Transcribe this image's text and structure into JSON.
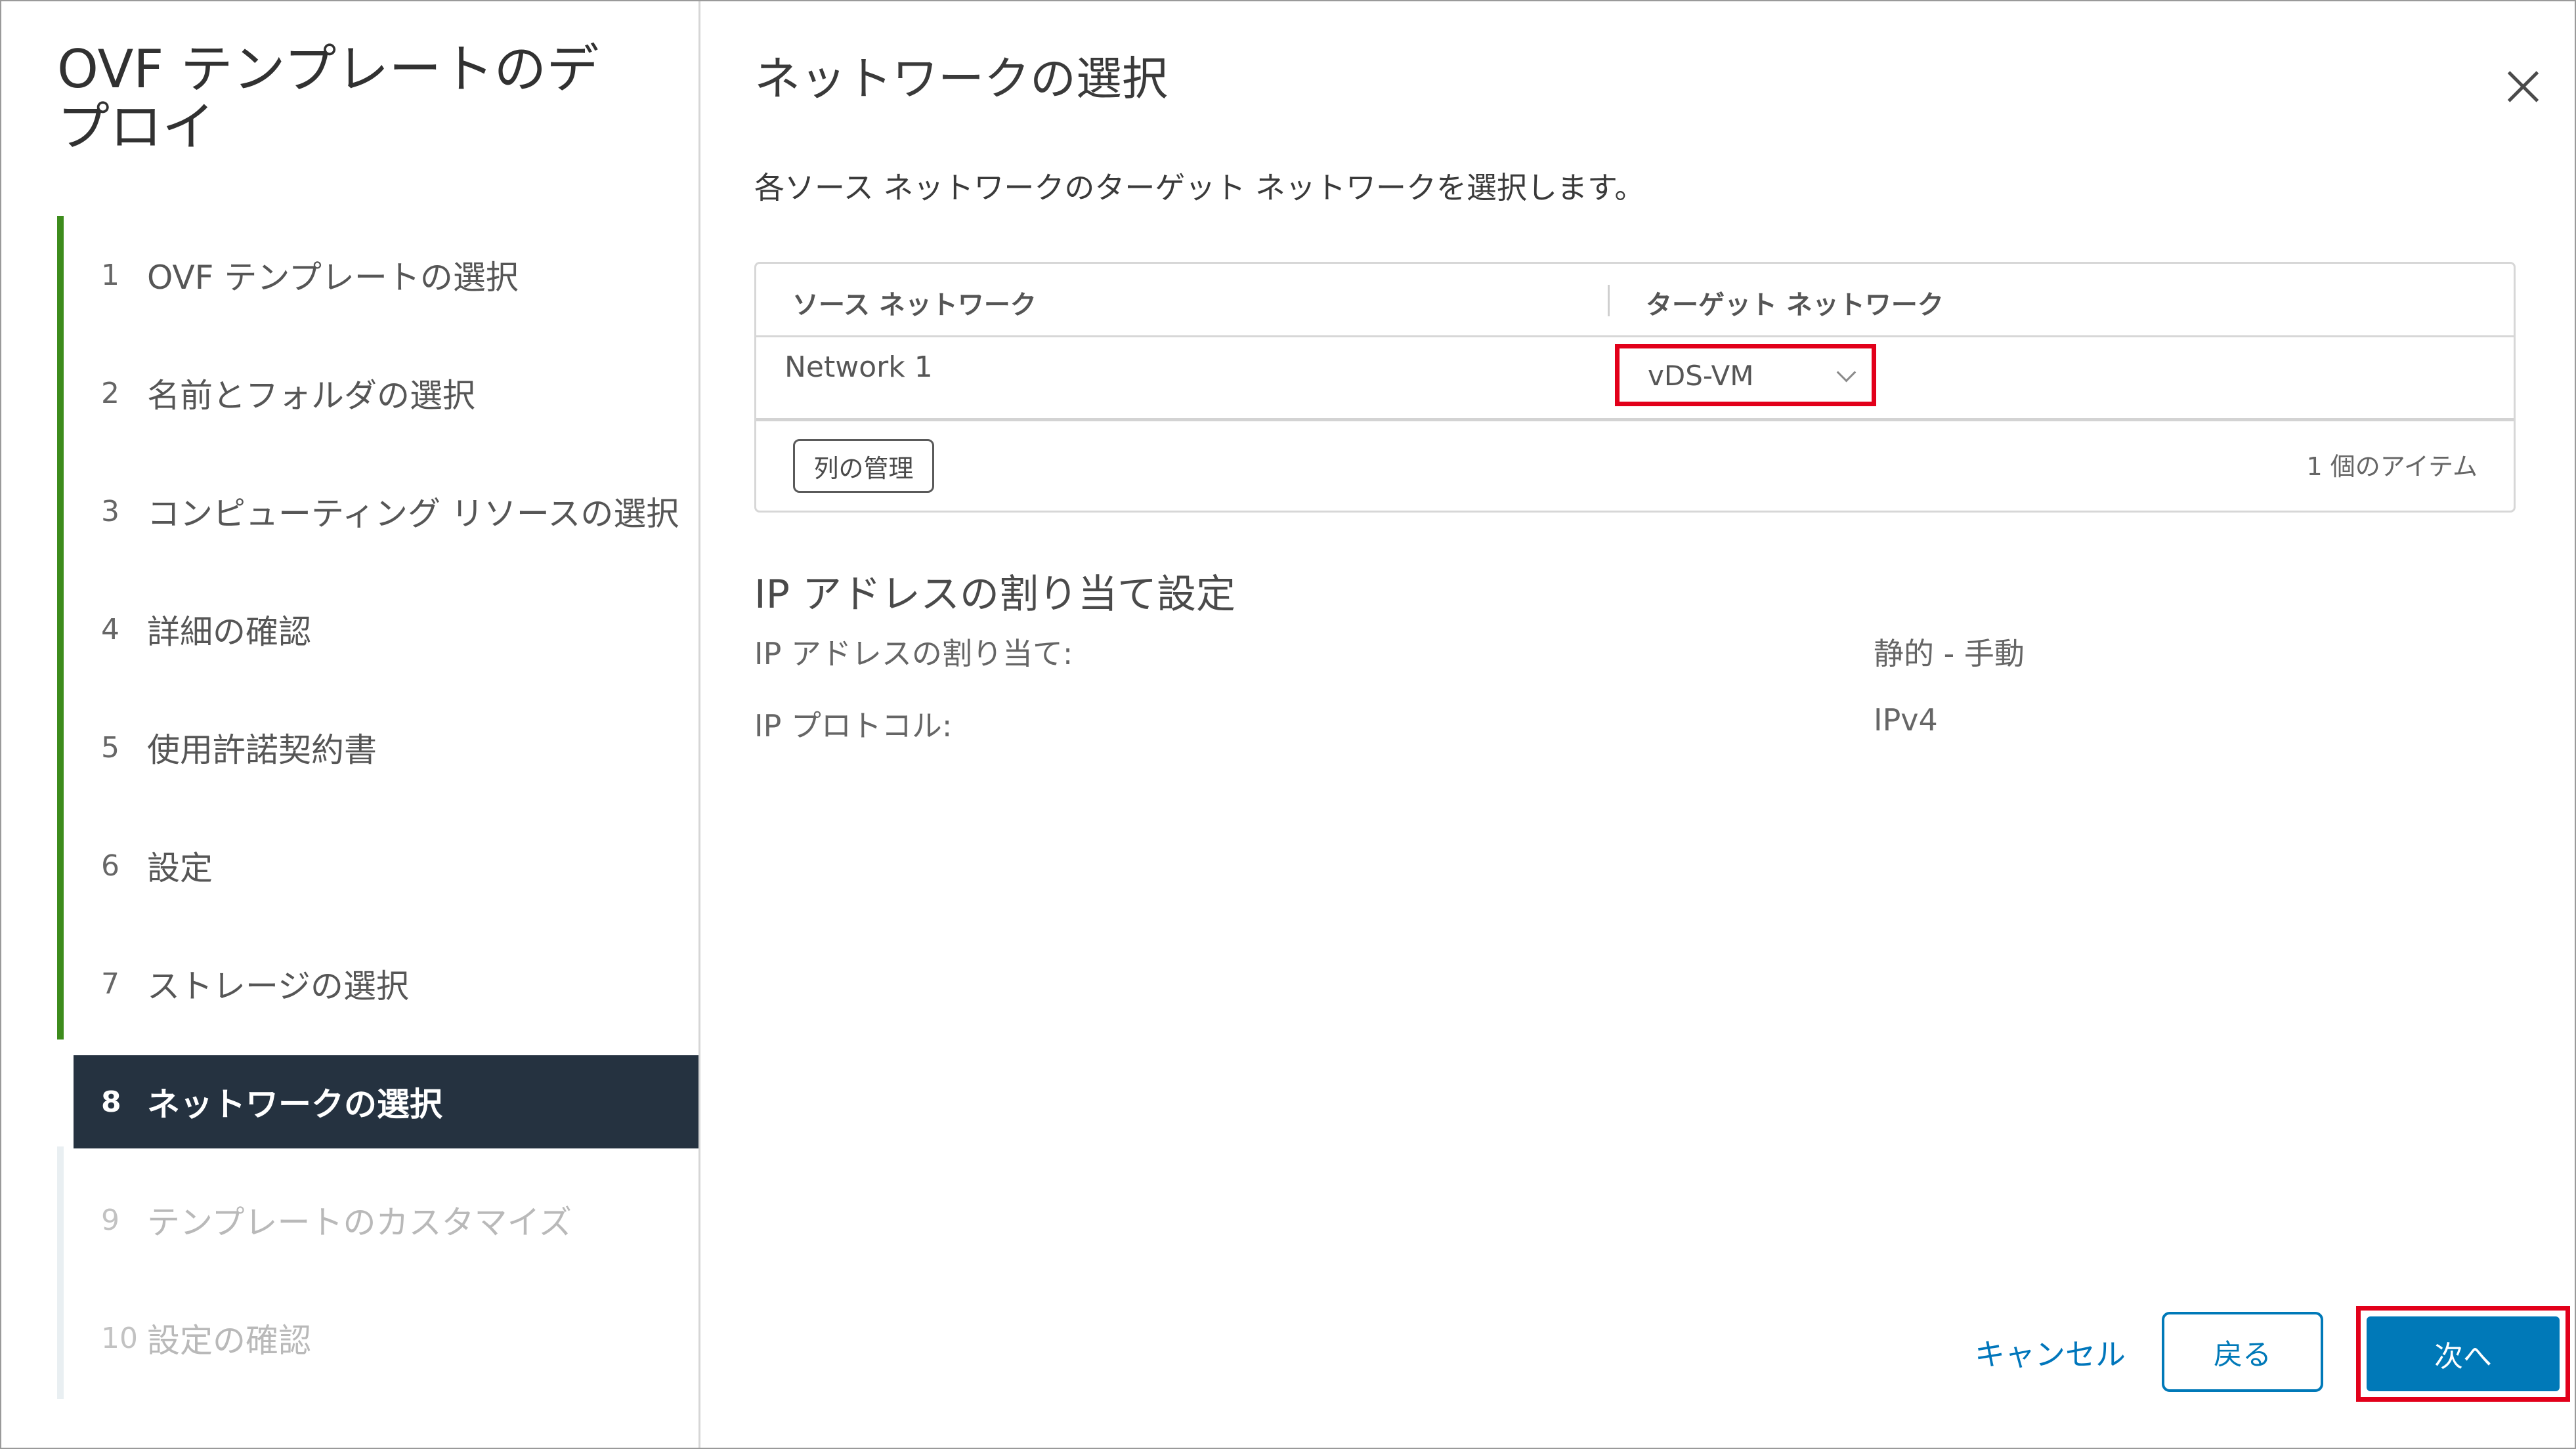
{
  "wizard": {
    "title": "OVF テンプレートのデプロイ",
    "steps": [
      {
        "num": "1",
        "label": "OVF テンプレートの選択"
      },
      {
        "num": "2",
        "label": "名前とフォルダの選択"
      },
      {
        "num": "3",
        "label": "コンピューティング リソースの選択"
      },
      {
        "num": "4",
        "label": "詳細の確認"
      },
      {
        "num": "5",
        "label": "使用許諾契約書"
      },
      {
        "num": "6",
        "label": "設定"
      },
      {
        "num": "7",
        "label": "ストレージの選択"
      },
      {
        "num": "8",
        "label": "ネットワークの選択"
      },
      {
        "num": "9",
        "label": "テンプレートのカスタマイズ"
      },
      {
        "num": "10",
        "label": "設定の確認"
      }
    ]
  },
  "page": {
    "title": "ネットワークの選択",
    "subtitle": "各ソース ネットワークのターゲット ネットワークを選択します。"
  },
  "grid": {
    "columns": [
      "ソース ネットワーク",
      "ターゲット ネットワーク"
    ],
    "rows": [
      {
        "source": "Network 1",
        "target": "vDS-VM"
      }
    ],
    "manage_columns_label": "列の管理",
    "item_count": "1 個のアイテム"
  },
  "ip": {
    "section_title": "IP アドレスの割り当て設定",
    "allocation_label": "IP アドレスの割り当て:",
    "allocation_value": "静的 - 手動",
    "protocol_label": "IP プロトコル:",
    "protocol_value": "IPv4"
  },
  "footer": {
    "cancel_label": "キャンセル",
    "back_label": "戻る",
    "next_label": "次へ"
  },
  "colors": {
    "progress": "#3d8c1c",
    "current_step_bg": "#253240",
    "primary": "#0079b8",
    "highlight": "#e2001a"
  },
  "icons": [
    "close-icon",
    "chevron-down-icon"
  ]
}
